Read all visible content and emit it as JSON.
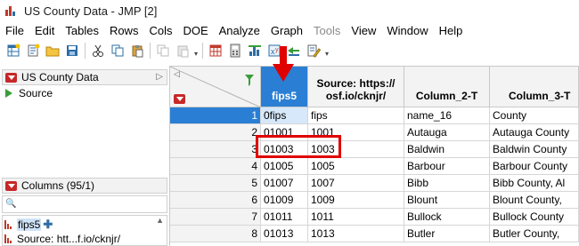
{
  "window": {
    "title": "US County Data - JMP [2]"
  },
  "menu": [
    "File",
    "Edit",
    "Tables",
    "Rows",
    "Cols",
    "DOE",
    "Analyze",
    "Graph",
    "Tools",
    "View",
    "Window",
    "Help"
  ],
  "toolbar_icons": [
    "new-table-icon",
    "new-script-icon",
    "open-folder-icon",
    "save-icon",
    "cut-icon",
    "copy-icon",
    "paste-icon",
    "disabled-copy-icon",
    "disabled-paste-icon",
    "data-grid-icon",
    "calculator-icon",
    "distribution-icon",
    "xy-icon",
    "fit-model-icon",
    "script-pencil-icon"
  ],
  "left_panel": {
    "table_name": "US County Data",
    "source_label": "Source",
    "columns_header": "Columns (95/1)",
    "column_list": [
      {
        "name": "fips5",
        "extra": "✚"
      },
      {
        "name": "Source: htt...f.io/cknjr/"
      }
    ]
  },
  "grid": {
    "headers": [
      "fips5",
      "Source: https://\nosf.io/cknjr/",
      "Column_2-T",
      "Column_3-T"
    ],
    "rows": [
      {
        "n": "1",
        "cells": [
          "0fips",
          "fips",
          "name_16",
          "County"
        ]
      },
      {
        "n": "2",
        "cells": [
          "01001",
          "1001",
          "Autauga",
          "Autauga County"
        ]
      },
      {
        "n": "3",
        "cells": [
          "01003",
          "1003",
          "Baldwin",
          "Baldwin County"
        ]
      },
      {
        "n": "4",
        "cells": [
          "01005",
          "1005",
          "Barbour",
          "Barbour County"
        ]
      },
      {
        "n": "5",
        "cells": [
          "01007",
          "1007",
          "Bibb",
          "Bibb County, Al"
        ]
      },
      {
        "n": "6",
        "cells": [
          "01009",
          "1009",
          "Blount",
          "Blount County,"
        ]
      },
      {
        "n": "7",
        "cells": [
          "01011",
          "1011",
          "Bullock",
          "Bullock County"
        ]
      },
      {
        "n": "8",
        "cells": [
          "01013",
          "1013",
          "Butler",
          "Butler County, "
        ]
      }
    ]
  },
  "colors": {
    "selection_blue": "#2a7fd4",
    "annotation_red": "#e00000",
    "jmp_red": "#c62828"
  }
}
